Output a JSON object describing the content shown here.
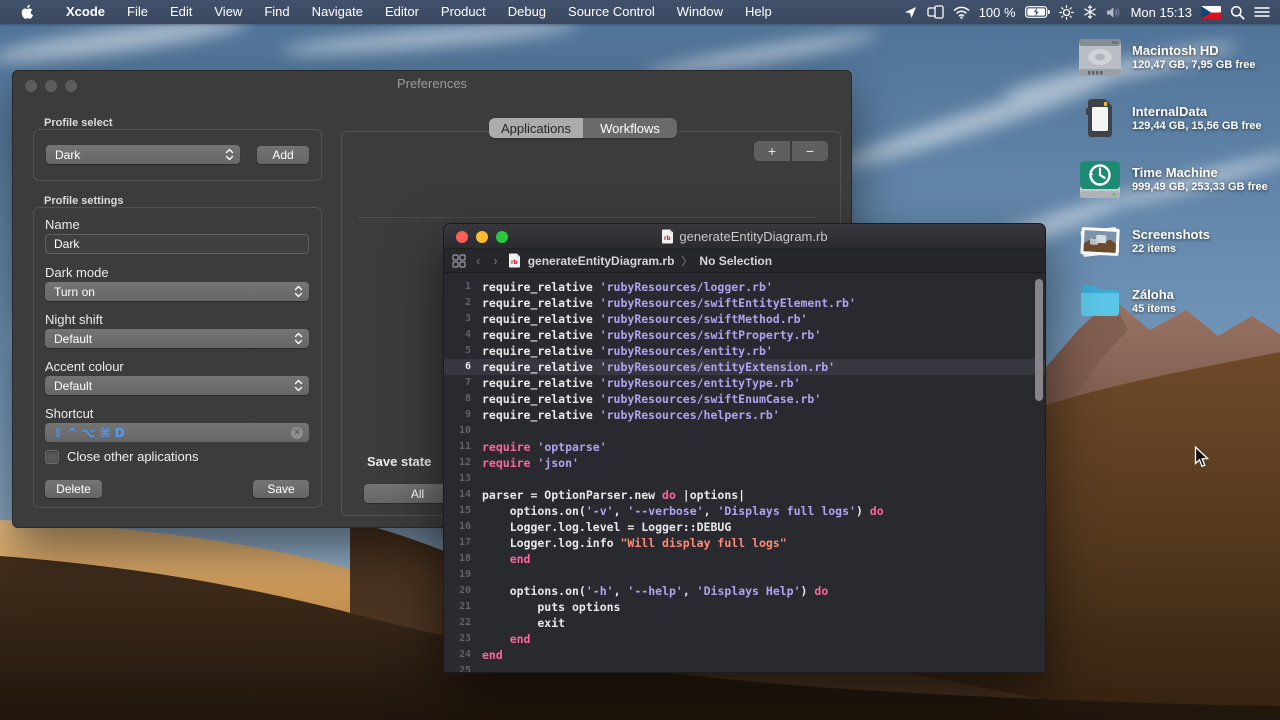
{
  "menu_bar": {
    "apple": "apple-logo",
    "items": [
      "Xcode",
      "File",
      "Edit",
      "View",
      "Find",
      "Navigate",
      "Editor",
      "Product",
      "Debug",
      "Source Control",
      "Window",
      "Help"
    ],
    "status": {
      "battery": "100 %",
      "clock": "Mon 15:13"
    }
  },
  "preferences_window": {
    "title": "Preferences",
    "profile_select": {
      "label": "Profile select",
      "value": "Dark",
      "add": "Add"
    },
    "profile_settings": {
      "label": "Profile settings",
      "name": {
        "label": "Name",
        "value": "Dark"
      },
      "dark_mode": {
        "label": "Dark mode",
        "value": "Turn on"
      },
      "night_shift": {
        "label": "Night shift",
        "value": "Default"
      },
      "accent_colour": {
        "label": "Accent colour",
        "value": "Default"
      },
      "shortcut": {
        "label": "Shortcut",
        "value": "⇧ ^ ⌥ ⌘  D",
        "clear": "✕"
      },
      "close_other": {
        "label": "Close other aplications",
        "checked": false
      },
      "delete": "Delete",
      "save": "Save"
    },
    "right_panel": {
      "tabs": [
        {
          "label": "Applications",
          "selected": true
        },
        {
          "label": "Workflows",
          "selected": false
        }
      ],
      "add": "+",
      "remove": "−",
      "save_state_label": "Save state",
      "all_button": "All"
    }
  },
  "editor_window": {
    "title": "generateEntityDiagram.rb",
    "jump_bar": {
      "file": "generateEntityDiagram.rb",
      "separator": "〉",
      "selection": "No Selection"
    },
    "code": {
      "current_line": 6,
      "lines": [
        [
          [
            "p",
            "require_relative "
          ],
          [
            "s",
            "'rubyResources/logger.rb'"
          ]
        ],
        [
          [
            "p",
            "require_relative "
          ],
          [
            "s",
            "'rubyResources/swiftEntityElement.rb'"
          ]
        ],
        [
          [
            "p",
            "require_relative "
          ],
          [
            "s",
            "'rubyResources/swiftMethod.rb'"
          ]
        ],
        [
          [
            "p",
            "require_relative "
          ],
          [
            "s",
            "'rubyResources/swiftProperty.rb'"
          ]
        ],
        [
          [
            "p",
            "require_relative "
          ],
          [
            "s",
            "'rubyResources/entity.rb'"
          ]
        ],
        [
          [
            "p",
            "require_relative "
          ],
          [
            "s",
            "'rubyResources/entityExtension.rb'"
          ]
        ],
        [
          [
            "p",
            "require_relative "
          ],
          [
            "s",
            "'rubyResources/entityType.rb'"
          ]
        ],
        [
          [
            "p",
            "require_relative "
          ],
          [
            "s",
            "'rubyResources/swiftEnumCase.rb'"
          ]
        ],
        [
          [
            "p",
            "require_relative "
          ],
          [
            "s",
            "'rubyResources/helpers.rb'"
          ]
        ],
        [],
        [
          [
            "k",
            "require "
          ],
          [
            "s",
            "'optparse'"
          ]
        ],
        [
          [
            "k",
            "require "
          ],
          [
            "s",
            "'json'"
          ]
        ],
        [],
        [
          [
            "p",
            "parser = OptionParser.new "
          ],
          [
            "k",
            "do"
          ],
          [
            "p",
            " |options|"
          ]
        ],
        [
          [
            "p",
            "    options.on("
          ],
          [
            "s",
            "'-v'"
          ],
          [
            "p",
            ", "
          ],
          [
            "s",
            "'--verbose'"
          ],
          [
            "p",
            ", "
          ],
          [
            "s",
            "'Displays full logs'"
          ],
          [
            "p",
            ") "
          ],
          [
            "k",
            "do"
          ]
        ],
        [
          [
            "p",
            "    Logger.log.level = Logger::DEBUG"
          ]
        ],
        [
          [
            "p",
            "    Logger.log.info "
          ],
          [
            "d",
            "\"Will display full logs\""
          ]
        ],
        [
          [
            "p",
            "    "
          ],
          [
            "k",
            "end"
          ]
        ],
        [],
        [
          [
            "p",
            "    options.on("
          ],
          [
            "s",
            "'-h'"
          ],
          [
            "p",
            ", "
          ],
          [
            "s",
            "'--help'"
          ],
          [
            "p",
            ", "
          ],
          [
            "s",
            "'Displays Help'"
          ],
          [
            "p",
            ") "
          ],
          [
            "k",
            "do"
          ]
        ],
        [
          [
            "p",
            "        puts options"
          ]
        ],
        [
          [
            "p",
            "        exit"
          ]
        ],
        [
          [
            "p",
            "    "
          ],
          [
            "k",
            "end"
          ]
        ],
        [
          [
            "k",
            "end"
          ]
        ],
        []
      ]
    }
  },
  "desktop_icons": [
    {
      "name": "Macintosh HD",
      "detail": "120,47 GB, 7,95 GB free"
    },
    {
      "name": "InternalData",
      "detail": "129,44 GB, 15,56 GB free"
    },
    {
      "name": "Time Machine",
      "detail": "999,49 GB, 253,33 GB free"
    },
    {
      "name": "Screenshots",
      "detail": "22 items"
    },
    {
      "name": "Záloha",
      "detail": "45 items"
    }
  ],
  "colors": {
    "menu_bar_bg": "#3e4c63",
    "window_bg": "#3c3c3c",
    "editor_bg": "#292a2f",
    "keyword": "#ff64a1",
    "string_single": "#aea5f2",
    "string_double": "#ff8a75",
    "shortcut_blue": "#4b9cfd",
    "tab_selected_bg": "#acacac"
  }
}
